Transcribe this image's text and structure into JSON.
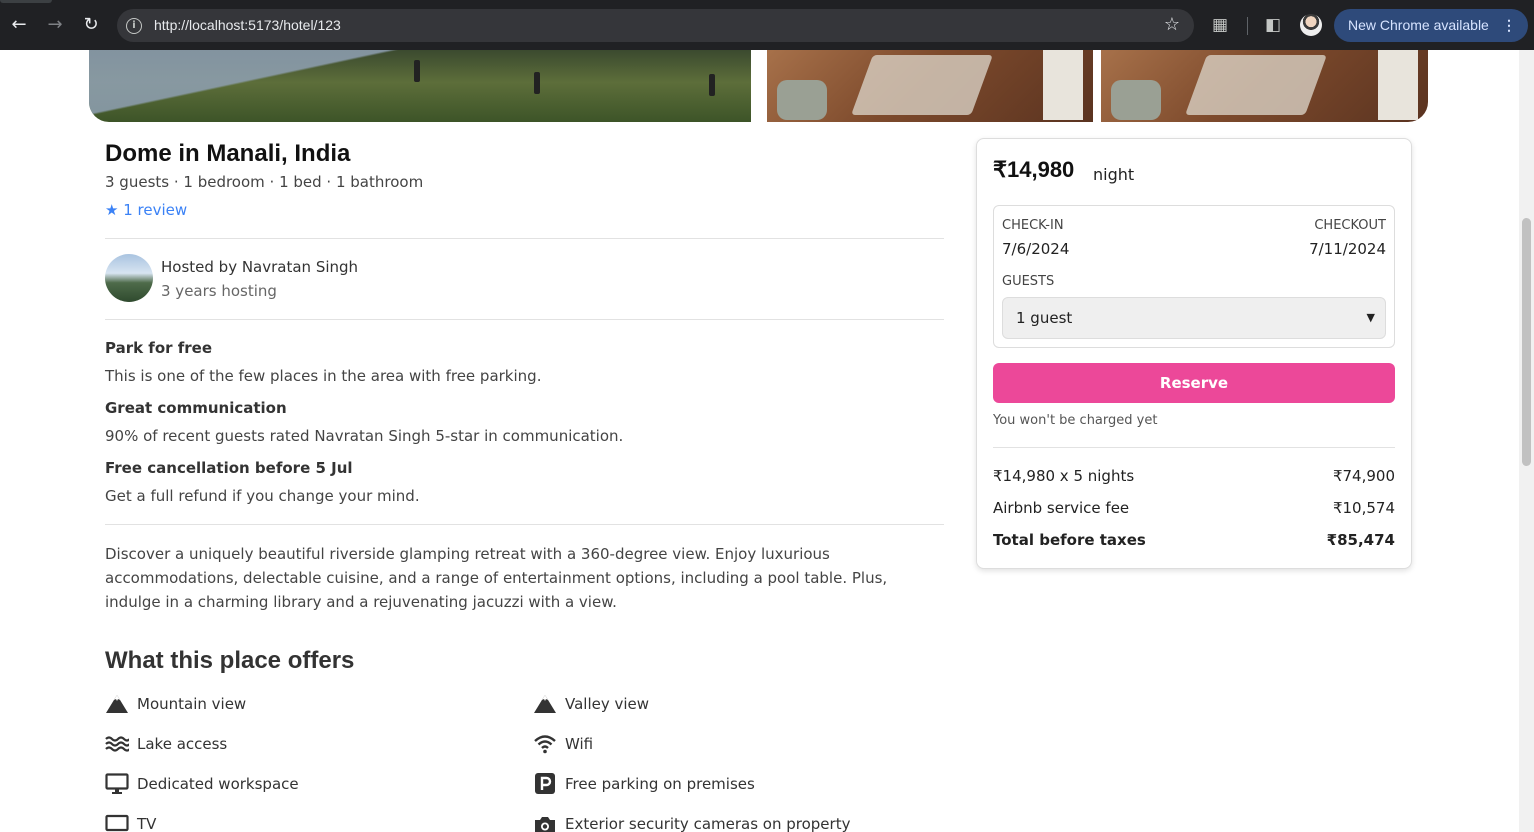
{
  "browser": {
    "url": "http://localhost:5173/hotel/123",
    "update_label": "New Chrome available"
  },
  "listing": {
    "title": "Dome in Manali, India",
    "subtitle": "3 guests · 1 bedroom · 1 bed · 1 bathroom",
    "reviews": "★ 1 review"
  },
  "host": {
    "name": "Hosted by Navratan Singh",
    "years": "3 years hosting"
  },
  "highlights": [
    {
      "title": "Park for free",
      "desc": "This is one of the few places in the area with free parking."
    },
    {
      "title": "Great communication",
      "desc": "90% of recent guests rated Navratan Singh 5-star in communication."
    },
    {
      "title": "Free cancellation before 5 Jul",
      "desc": "Get a full refund if you change your mind."
    }
  ],
  "description": "Discover a uniquely beautiful riverside glamping retreat with a 360-degree view. Enjoy luxurious accommodations, delectable cuisine, and a range of entertainment options, including a pool table. Plus, indulge in a charming library and a rejuvenating jacuzzi with a view.",
  "offers": {
    "title": "What this place offers",
    "items": [
      {
        "label": "Mountain view",
        "icon": "mountain-icon"
      },
      {
        "label": "Valley view",
        "icon": "mountain-icon"
      },
      {
        "label": "Lake access",
        "icon": "waves-icon"
      },
      {
        "label": "Wifi",
        "icon": "wifi-icon"
      },
      {
        "label": "Dedicated workspace",
        "icon": "monitor-icon"
      },
      {
        "label": "Free parking on premises",
        "icon": "parking-icon"
      },
      {
        "label": "TV",
        "icon": "tv-icon"
      },
      {
        "label": "Exterior security cameras on property",
        "icon": "camera-icon"
      }
    ]
  },
  "booking": {
    "price": "₹14,980",
    "price_unit": "night",
    "checkin_label": "CHECK-IN",
    "checkin_value": "7/6/2024",
    "checkout_label": "CHECKOUT",
    "checkout_value": "7/11/2024",
    "guests_label": "GUESTS",
    "guests_value": "1 guest",
    "reserve_label": "Reserve",
    "no_charge": "You won't be charged yet",
    "lines": [
      {
        "label": "₹14,980 x 5 nights",
        "value": "₹74,900"
      },
      {
        "label": "Airbnb service fee",
        "value": "₹10,574"
      },
      {
        "label": "Total before taxes",
        "value": "₹85,474"
      }
    ],
    "accent_color": "#ec4899"
  }
}
